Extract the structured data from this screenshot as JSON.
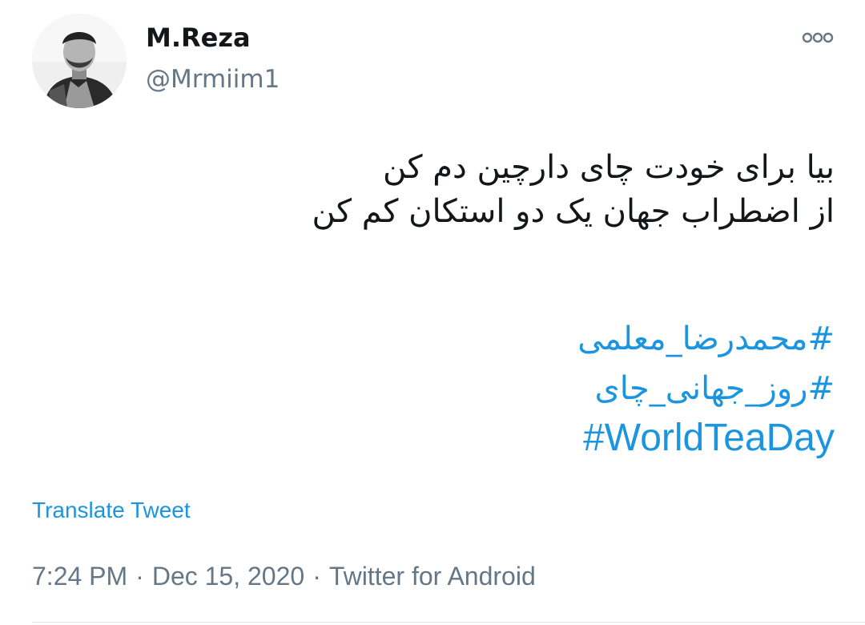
{
  "author": {
    "name": "M.Reza",
    "handle": "@Mrmiim1"
  },
  "tweet": {
    "lines": [
      "بیا برای خودت چای دارچین دم کن",
      "از اضطراب جهان یک دو استکان کم کن"
    ],
    "hashtags": [
      "#محمدرضا_معلمی",
      "#روز_جهانی_چای",
      "#WorldTeaDay"
    ]
  },
  "translate_label": "Translate Tweet",
  "meta": {
    "time": "7:24 PM",
    "separator": "·",
    "date": "Dec 15, 2020",
    "source": "Twitter for Android"
  },
  "colors": {
    "link": "#1b95e0",
    "secondary_text": "#657786",
    "primary_text": "#14171a",
    "divider": "#e1e8ed"
  },
  "icons": {
    "more": "more-horizontal-icon"
  }
}
